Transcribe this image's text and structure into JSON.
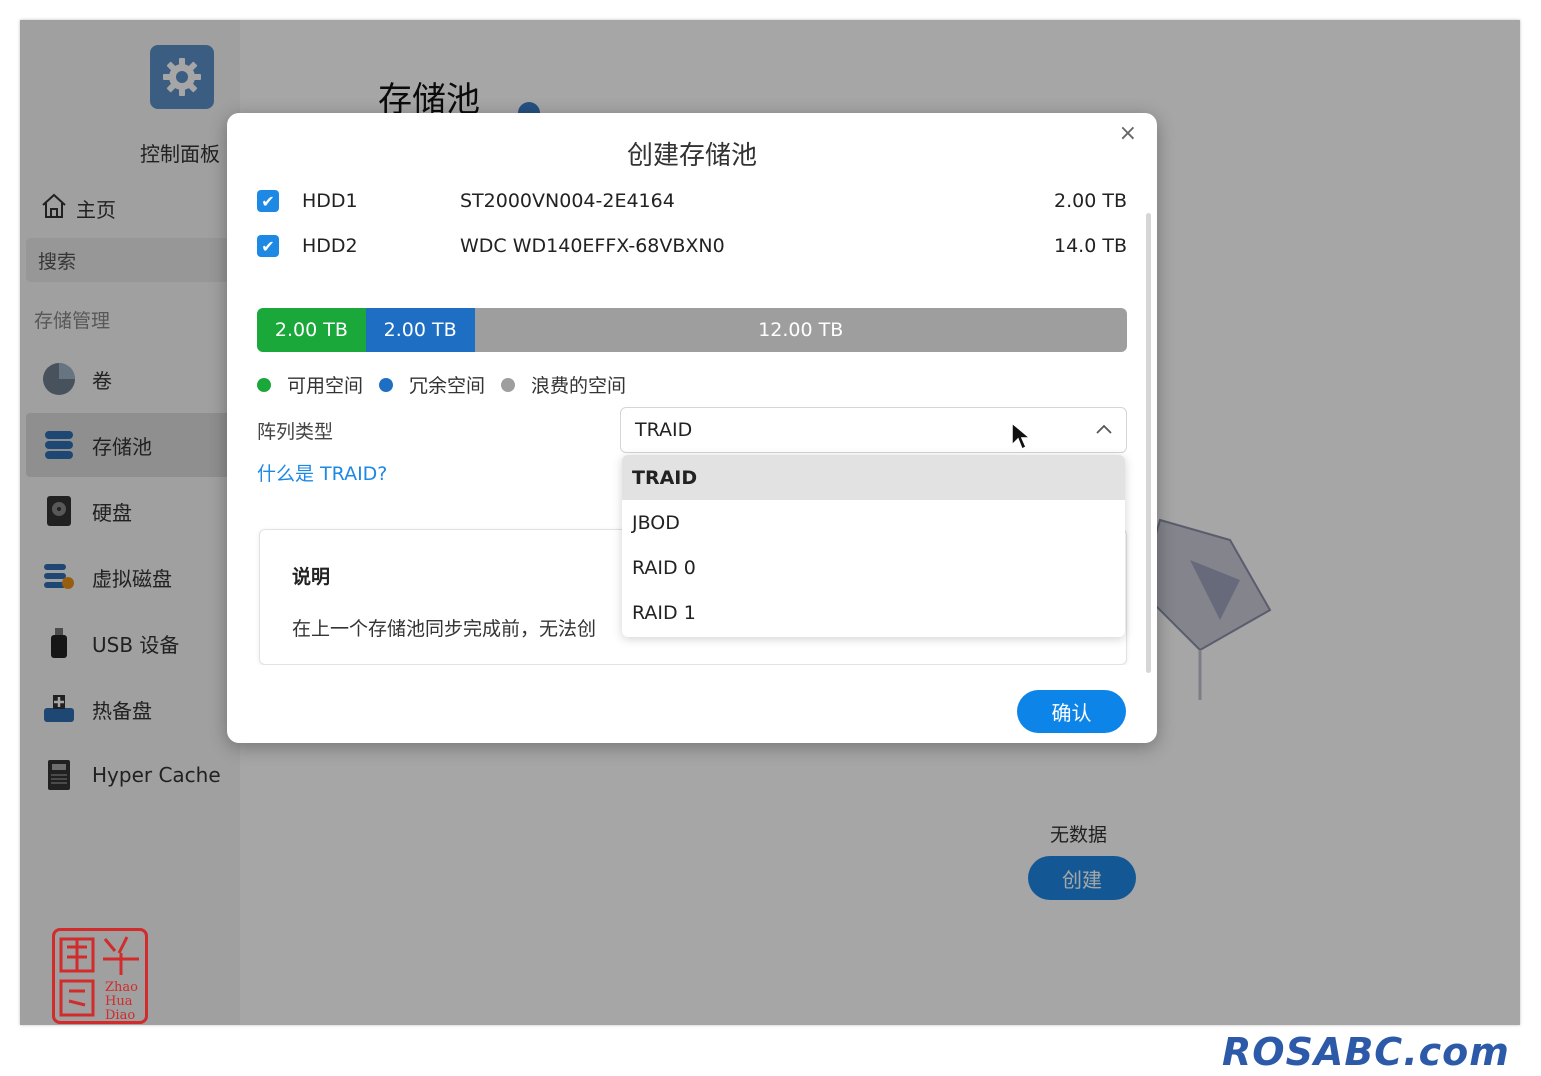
{
  "sidebar": {
    "control_panel_label": "控制面板",
    "home_label": "主页",
    "search_placeholder": "搜索",
    "group_title": "存储管理",
    "items": [
      {
        "label": "卷",
        "icon": "pie-chart-icon"
      },
      {
        "label": "存储池",
        "icon": "database-stack-icon"
      },
      {
        "label": "硬盘",
        "icon": "hard-disk-icon"
      },
      {
        "label": "虚拟磁盘",
        "icon": "virtual-disk-icon"
      },
      {
        "label": "USB 设备",
        "icon": "usb-drive-icon"
      },
      {
        "label": "热备盘",
        "icon": "hot-spare-icon"
      },
      {
        "label": "Hyper Cache",
        "icon": "ssd-cache-icon"
      }
    ]
  },
  "main": {
    "page_title": "存储池",
    "empty_text": "无数据",
    "create_label": "创建"
  },
  "modal": {
    "title": "创建存储池",
    "close_icon": "×",
    "disks": [
      {
        "checked": true,
        "name": "HDD1",
        "model": "ST2000VN004-2E4164",
        "size": "2.00 TB"
      },
      {
        "checked": true,
        "name": "HDD2",
        "model": "WDC WD140EFFX-68VBXN0",
        "size": "14.0 TB"
      }
    ],
    "capacity_bar": [
      {
        "label": "2.00 TB",
        "value_tb": 2.0,
        "color": "#1aa83a"
      },
      {
        "label": "2.00 TB",
        "value_tb": 2.0,
        "color": "#1e6fc4"
      },
      {
        "label": "12.00 TB",
        "value_tb": 12.0,
        "color": "#9e9e9e"
      }
    ],
    "legend": [
      {
        "label": "可用空间",
        "color": "#1aa83a"
      },
      {
        "label": "冗余空间",
        "color": "#1e6fc4"
      },
      {
        "label": "浪费的空间",
        "color": "#9e9e9e"
      }
    ],
    "array_type_label": "阵列类型",
    "help_link": "什么是 TRAID?",
    "selected_array": "TRAID",
    "dropdown_options": [
      "TRAID",
      "JBOD",
      "RAID 0",
      "RAID 1"
    ],
    "description_title": "说明",
    "description_text": "在上一个存储池同步完成前，无法创",
    "confirm_label": "确认"
  },
  "watermarks": {
    "seal_text": [
      "昭",
      "华",
      "凋",
      "Zhao",
      "Hua",
      "Diao"
    ],
    "site": "ROSABC.com"
  },
  "colors": {
    "accent": "#1e88e5",
    "available": "#1aa83a",
    "redundant": "#1e6fc4",
    "wasted": "#9e9e9e"
  }
}
